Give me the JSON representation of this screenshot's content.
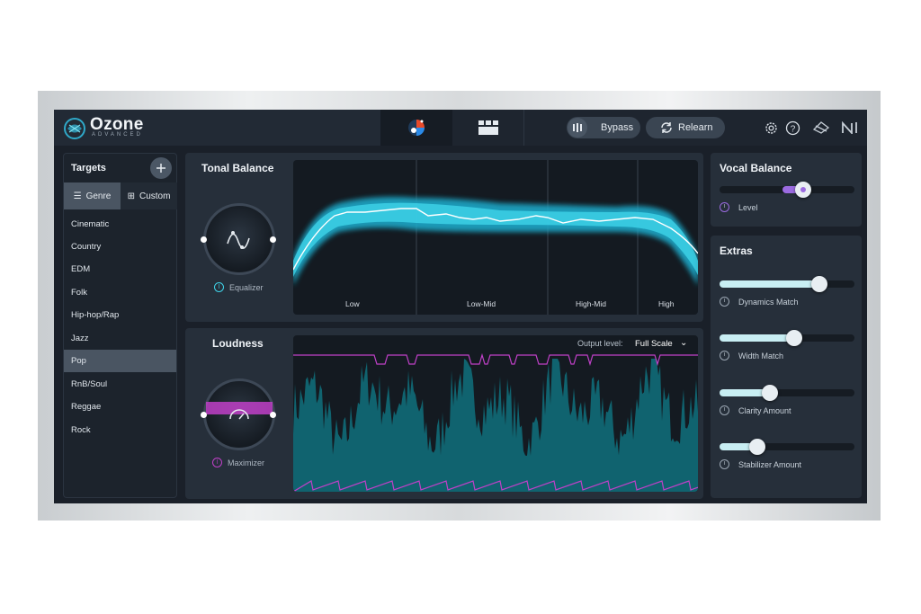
{
  "app": {
    "title": "Ozone",
    "subtitle": "ADVANCED"
  },
  "topbar": {
    "bypass_label": "Bypass",
    "relearn_label": "Relearn"
  },
  "targets": {
    "title": "Targets",
    "tabs": [
      {
        "label": "Genre",
        "selected": true
      },
      {
        "label": "Custom",
        "selected": false
      }
    ],
    "genres": [
      "Cinematic",
      "Country",
      "EDM",
      "Folk",
      "Hip-hop/Rap",
      "Jazz",
      "Pop",
      "RnB/Soul",
      "Reggae",
      "Rock"
    ],
    "selected_genre": "Pop"
  },
  "tonal_balance": {
    "title": "Tonal Balance",
    "knob_label": "Equalizer",
    "bands": [
      "Low",
      "Low-Mid",
      "High-Mid",
      "High"
    ]
  },
  "loudness": {
    "title": "Loudness",
    "knob_label": "Maximizer",
    "output_level_label": "Output level:",
    "output_level_value": "Full Scale"
  },
  "vocal_balance": {
    "title": "Vocal Balance",
    "level_label": "Level",
    "level_value": 0.62
  },
  "extras": {
    "title": "Extras",
    "sliders": [
      {
        "label": "Dynamics Match",
        "value": 0.74
      },
      {
        "label": "Width Match",
        "value": 0.55
      },
      {
        "label": "Clarity Amount",
        "value": 0.37
      },
      {
        "label": "Stabilizer Amount",
        "value": 0.28
      }
    ]
  },
  "colors": {
    "accent_cyan": "#3fd3e8",
    "accent_magenta": "#c040c8",
    "vocal_purple": "#9b6be0"
  }
}
